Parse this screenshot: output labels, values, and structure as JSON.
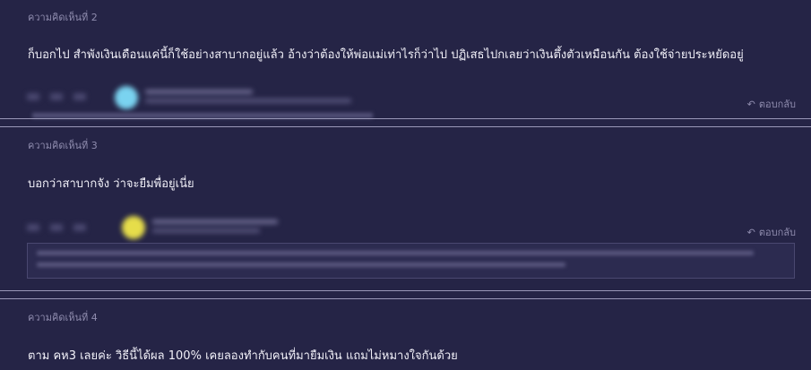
{
  "comments": [
    {
      "header": "ความคิดเห็นที่ 2",
      "body": "ก็บอกไป สำพังเงินเดือนแค่นี้ก็ใช้อย่างสาบากอยู่แล้ว อ้างว่าต้องให้พ่อแม่เท่าไรก็ว่าไป ปฏิเสธไปกเลยว่าเงินตึ้งตัวเหมือนกัน ต้องใช้จ่ายประหยัดอยู่",
      "reply_label": "ตอบกลับ"
    },
    {
      "header": "ความคิดเห็นที่ 3",
      "body": "บอกว่าสาบากจัง ว่าจะยืมพื่อยู่เนี่ย",
      "reply_label": "ตอบกลับ"
    },
    {
      "header": "ความคิดเห็นที่ 4",
      "body": "ตาม คห3 เลยค่ะ วิธีนี้ได้ผล 100% เคยลองทำกับคนที่มายืมเงิน แถมไม่หมางใจกันด้วย"
    }
  ],
  "icons": {
    "reply": "reply-arrow-icon",
    "avatar": "user-avatar-icon"
  },
  "colors": {
    "background": "#252446",
    "text": "#f1f0f8",
    "muted": "#8f8cae",
    "divider": "#9a98b8"
  }
}
